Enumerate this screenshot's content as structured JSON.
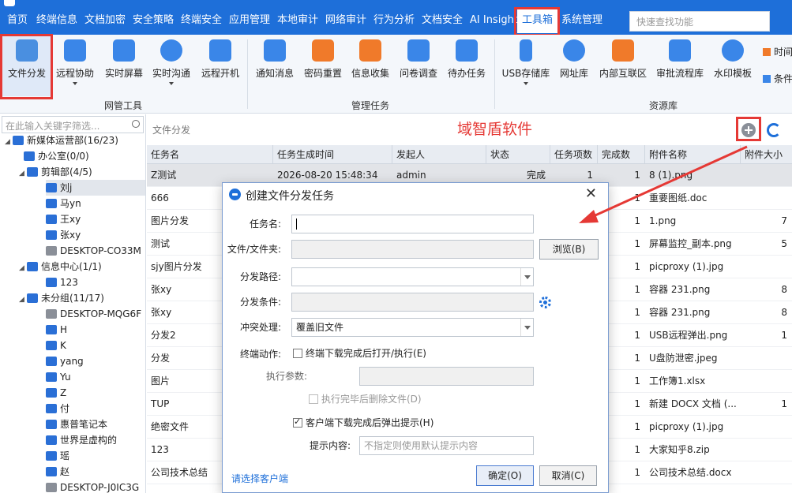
{
  "menu": {
    "items": [
      "首页",
      "终端信息",
      "文档加密",
      "安全策略",
      "终端安全",
      "应用管理",
      "本地审计",
      "网络审计",
      "行为分析",
      "文档安全",
      "AI Insight",
      "工具箱",
      "系统管理"
    ],
    "active_index": 11,
    "search_placeholder": "快速查找功能"
  },
  "toolbar": {
    "groups": {
      "netmgmt": "网管工具",
      "tasks": "管理任务",
      "resources": "资源库"
    },
    "buttons": [
      "文件分发",
      "远程协助",
      "实时屏幕",
      "实时沟通",
      "远程开机",
      "通知消息",
      "密码重置",
      "信息收集",
      "问卷调查",
      "待办任务",
      "USB存储库",
      "网址库",
      "内部互联区",
      "审批流程库",
      "水印模板"
    ],
    "side_items": [
      "时间",
      "条件"
    ]
  },
  "filter_placeholder": "在此输入关键字筛选...",
  "tree": [
    {
      "label": "新媒体运营部(16/23)"
    },
    {
      "label": "办公室(0/0)"
    },
    {
      "label": "剪辑部(4/5)"
    },
    {
      "label": "刘j"
    },
    {
      "label": "马yn"
    },
    {
      "label": "王xy"
    },
    {
      "label": "张xy"
    },
    {
      "label": "DESKTOP-CO33M"
    },
    {
      "label": "信息中心(1/1)"
    },
    {
      "label": "123"
    },
    {
      "label": "未分组(11/17)"
    },
    {
      "label": "DESKTOP-MQG6F"
    },
    {
      "label": "H"
    },
    {
      "label": "K"
    },
    {
      "label": "yang"
    },
    {
      "label": "Yu"
    },
    {
      "label": "Z"
    },
    {
      "label": "付"
    },
    {
      "label": "惠普笔记本"
    },
    {
      "label": "世界是虚构的"
    },
    {
      "label": "瑶"
    },
    {
      "label": "赵"
    },
    {
      "label": "DESKTOP-J0IC3G"
    }
  ],
  "content": {
    "breadcrumb": "文件分发",
    "brand": "域智盾软件"
  },
  "table": {
    "columns": [
      "任务名",
      "任务生成时间",
      "发起人",
      "状态",
      "任务项数",
      "完成数",
      "附件名称",
      "附件大小"
    ],
    "rows": [
      {
        "name": "Z测试",
        "time": "2026-08-20 15:48:34",
        "initiator": "admin",
        "status": "完成",
        "items": "1",
        "done": "1",
        "attachment": "8 (1).png",
        "size": ""
      },
      {
        "name": "666",
        "time": "",
        "initiator": "",
        "status": "",
        "items": "",
        "done": "1",
        "attachment": "重要图纸.doc",
        "size": ""
      },
      {
        "name": "图片分发",
        "time": "",
        "initiator": "",
        "status": "",
        "items": "",
        "done": "1",
        "attachment": "1.png",
        "size": "7"
      },
      {
        "name": "测试",
        "time": "",
        "initiator": "",
        "status": "",
        "items": "",
        "done": "1",
        "attachment": "屏幕监控_副本.png",
        "size": "5"
      },
      {
        "name": "sjy图片分发",
        "time": "",
        "initiator": "",
        "status": "",
        "items": "",
        "done": "1",
        "attachment": "picproxy (1).jpg",
        "size": ""
      },
      {
        "name": "张xy",
        "time": "",
        "initiator": "",
        "status": "",
        "items": "",
        "done": "1",
        "attachment": "容器 231.png",
        "size": "8"
      },
      {
        "name": "张xy",
        "time": "",
        "initiator": "",
        "status": "",
        "items": "",
        "done": "1",
        "attachment": "容器 231.png",
        "size": "8"
      },
      {
        "name": "分发2",
        "time": "",
        "initiator": "",
        "status": "",
        "items": "",
        "done": "1",
        "attachment": "USB远程弹出.png",
        "size": "1"
      },
      {
        "name": "分发",
        "time": "",
        "initiator": "",
        "status": "",
        "items": "",
        "done": "1",
        "attachment": "U盘防泄密.jpeg",
        "size": ""
      },
      {
        "name": "图片",
        "time": "",
        "initiator": "",
        "status": "",
        "items": "",
        "done": "1",
        "attachment": "工作簿1.xlsx",
        "size": ""
      },
      {
        "name": "TUP",
        "time": "",
        "initiator": "",
        "status": "",
        "items": "",
        "done": "1",
        "attachment": "新建 DOCX 文档 (...",
        "size": "1"
      },
      {
        "name": "绝密文件",
        "time": "",
        "initiator": "",
        "status": "",
        "items": "",
        "done": "1",
        "attachment": "picproxy (1).jpg",
        "size": ""
      },
      {
        "name": "123",
        "time": "",
        "initiator": "",
        "status": "",
        "items": "",
        "done": "1",
        "attachment": "大家知乎8.zip",
        "size": ""
      },
      {
        "name": "公司技术总结",
        "time": "",
        "initiator": "",
        "status": "",
        "items": "",
        "done": "1",
        "attachment": "公司技术总结.docx",
        "size": ""
      }
    ]
  },
  "dialog": {
    "title": "创建文件分发任务",
    "fields": {
      "task_name_label": "任务名:",
      "file_label": "文件/文件夹:",
      "browse_label": "浏览(B)",
      "path_label": "分发路径:",
      "cond_label": "分发条件:",
      "conflict_label": "冲突处理:",
      "conflict_value": "覆盖旧文件",
      "action_label": "终端动作:",
      "open_after_label": "终端下载完成后打开/执行(E)",
      "params_label": "执行参数:",
      "delete_after_label": "执行完毕后删除文件(D)",
      "popup_label": "客户端下载完成后弹出提示(H)",
      "tip_label": "提示内容:",
      "tip_placeholder": "不指定则使用默认提示内容"
    },
    "select_clients_link": "请选择客户端",
    "ok_label": "确定(O)",
    "cancel_label": "取消(C)"
  },
  "colors": {
    "accent": "#1e6fd9",
    "highlight": "#e53935",
    "header_bg": "#e8ecf2"
  }
}
